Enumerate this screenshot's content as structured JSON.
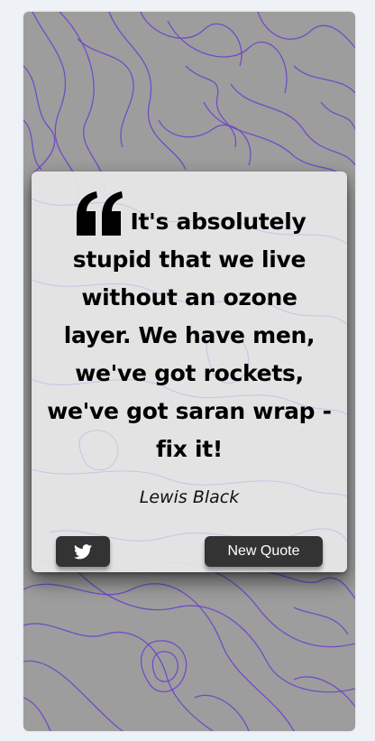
{
  "quote": {
    "text": "It's absolutely stupid that we live without an ozone layer. We have men, we've got rockets, we've got saran wrap - fix it!",
    "author": "Lewis Black"
  },
  "buttons": {
    "tweet_icon": "twitter-icon",
    "new_quote_label": "New Quote"
  },
  "colors": {
    "page_background": "#eef2f7",
    "frame_background": "#9d9d9d",
    "contour_lines": "#6a3ecf",
    "card_background": "#e8e8e8",
    "button_background": "#333333",
    "button_text": "#ffffff"
  }
}
